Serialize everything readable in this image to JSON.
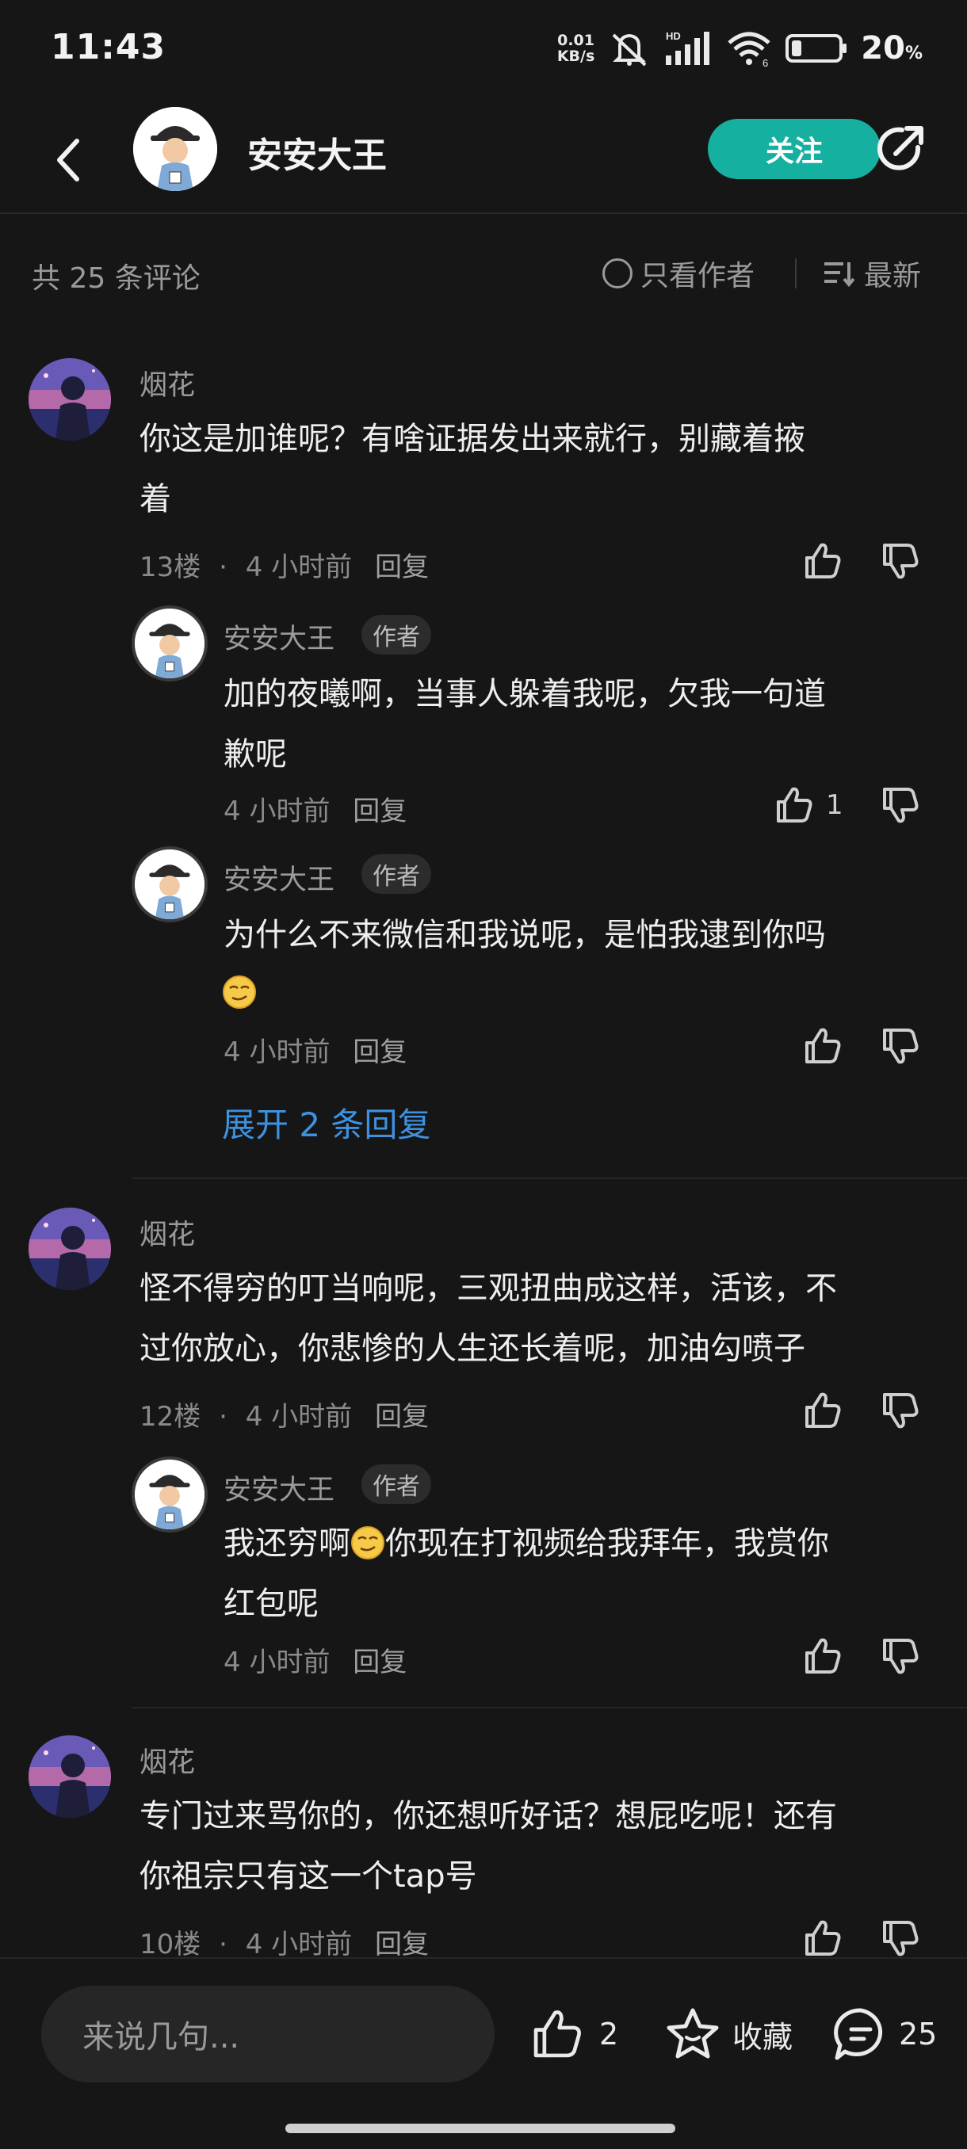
{
  "status": {
    "time": "11:43",
    "speed_value": "0.01",
    "speed_unit": "KB/s",
    "hd": "HD",
    "wifi_level": "6",
    "battery": "20",
    "battery_unit": "%"
  },
  "header": {
    "title": "安安大王",
    "follow_label": "关注"
  },
  "toolbar": {
    "count": "共 25 条评论",
    "only_author": "只看作者",
    "sort": "最新"
  },
  "comments": [
    {
      "user": "烟花",
      "text1": "你这是加谁呢？有啥证据发出来就行，别藏着掖",
      "text2": "着",
      "floor": "13楼",
      "time": "4 小时前",
      "reply": "回复",
      "replies": [
        {
          "user": "安安大王",
          "badge": "作者",
          "text1": "加的夜曦啊，当事人躲着我呢，欠我一句道",
          "text2": "歉呢",
          "time": "4 小时前",
          "reply": "回复",
          "likes": "1"
        },
        {
          "user": "安安大王",
          "badge": "作者",
          "text1": "为什么不来微信和我说呢，是怕我逮到你吗",
          "time": "4 小时前",
          "reply": "回复"
        }
      ],
      "expand": "展开 2 条回复"
    },
    {
      "user": "烟花",
      "text1": "怪不得穷的叮当响呢，三观扭曲成这样，活该，不",
      "text2": "过你放心，你悲惨的人生还长着呢，加油勾喷子",
      "floor": "12楼",
      "time": "4 小时前",
      "reply": "回复",
      "replies": [
        {
          "user": "安安大王",
          "badge": "作者",
          "text1a": "我还穷啊",
          "text1b": "你现在打视频给我拜年，我赏你",
          "text2": "红包呢",
          "time": "4 小时前",
          "reply": "回复"
        }
      ]
    },
    {
      "user": "烟花",
      "text1": "专门过来骂你的，你还想听好话？想屁吃呢！还有",
      "text2": "你祖宗只有这一个tap号",
      "floor": "10楼",
      "time": "4 小时前",
      "reply": "回复"
    }
  ],
  "bottom": {
    "placeholder": "来说几句...",
    "likes": "2",
    "fav_label": "收藏",
    "comments": "25"
  },
  "icons": [
    "back-icon",
    "share-icon",
    "thumb-up-icon",
    "thumb-down-icon",
    "star-icon",
    "comment-icon",
    "sort-icon",
    "wifi-icon",
    "signal-icon",
    "mute-icon",
    "battery-icon",
    "smirk-emoji"
  ],
  "colors": {
    "accent": "#16b0a0",
    "link": "#3d92e0",
    "background": "#161616"
  }
}
